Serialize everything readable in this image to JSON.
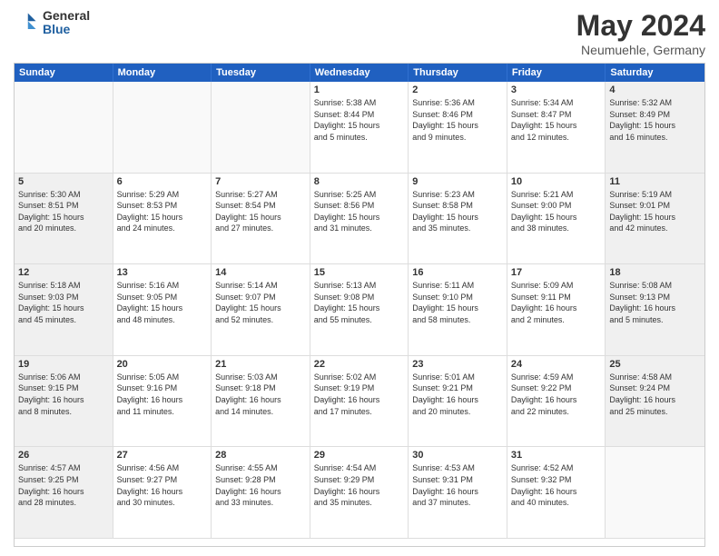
{
  "logo": {
    "general": "General",
    "blue": "Blue"
  },
  "header": {
    "month": "May 2024",
    "location": "Neumuehle, Germany"
  },
  "weekdays": [
    "Sunday",
    "Monday",
    "Tuesday",
    "Wednesday",
    "Thursday",
    "Friday",
    "Saturday"
  ],
  "weeks": [
    [
      {
        "day": "",
        "empty": true,
        "shaded": false
      },
      {
        "day": "",
        "empty": true,
        "shaded": false
      },
      {
        "day": "",
        "empty": true,
        "shaded": false
      },
      {
        "day": "1",
        "lines": [
          "Sunrise: 5:38 AM",
          "Sunset: 8:44 PM",
          "Daylight: 15 hours",
          "and 5 minutes."
        ]
      },
      {
        "day": "2",
        "lines": [
          "Sunrise: 5:36 AM",
          "Sunset: 8:46 PM",
          "Daylight: 15 hours",
          "and 9 minutes."
        ]
      },
      {
        "day": "3",
        "lines": [
          "Sunrise: 5:34 AM",
          "Sunset: 8:47 PM",
          "Daylight: 15 hours",
          "and 12 minutes."
        ]
      },
      {
        "day": "4",
        "lines": [
          "Sunrise: 5:32 AM",
          "Sunset: 8:49 PM",
          "Daylight: 15 hours",
          "and 16 minutes."
        ],
        "shaded": true
      }
    ],
    [
      {
        "day": "5",
        "lines": [
          "Sunrise: 5:30 AM",
          "Sunset: 8:51 PM",
          "Daylight: 15 hours",
          "and 20 minutes."
        ],
        "shaded": true
      },
      {
        "day": "6",
        "lines": [
          "Sunrise: 5:29 AM",
          "Sunset: 8:53 PM",
          "Daylight: 15 hours",
          "and 24 minutes."
        ]
      },
      {
        "day": "7",
        "lines": [
          "Sunrise: 5:27 AM",
          "Sunset: 8:54 PM",
          "Daylight: 15 hours",
          "and 27 minutes."
        ]
      },
      {
        "day": "8",
        "lines": [
          "Sunrise: 5:25 AM",
          "Sunset: 8:56 PM",
          "Daylight: 15 hours",
          "and 31 minutes."
        ]
      },
      {
        "day": "9",
        "lines": [
          "Sunrise: 5:23 AM",
          "Sunset: 8:58 PM",
          "Daylight: 15 hours",
          "and 35 minutes."
        ]
      },
      {
        "day": "10",
        "lines": [
          "Sunrise: 5:21 AM",
          "Sunset: 9:00 PM",
          "Daylight: 15 hours",
          "and 38 minutes."
        ]
      },
      {
        "day": "11",
        "lines": [
          "Sunrise: 5:19 AM",
          "Sunset: 9:01 PM",
          "Daylight: 15 hours",
          "and 42 minutes."
        ],
        "shaded": true
      }
    ],
    [
      {
        "day": "12",
        "lines": [
          "Sunrise: 5:18 AM",
          "Sunset: 9:03 PM",
          "Daylight: 15 hours",
          "and 45 minutes."
        ],
        "shaded": true
      },
      {
        "day": "13",
        "lines": [
          "Sunrise: 5:16 AM",
          "Sunset: 9:05 PM",
          "Daylight: 15 hours",
          "and 48 minutes."
        ]
      },
      {
        "day": "14",
        "lines": [
          "Sunrise: 5:14 AM",
          "Sunset: 9:07 PM",
          "Daylight: 15 hours",
          "and 52 minutes."
        ]
      },
      {
        "day": "15",
        "lines": [
          "Sunrise: 5:13 AM",
          "Sunset: 9:08 PM",
          "Daylight: 15 hours",
          "and 55 minutes."
        ]
      },
      {
        "day": "16",
        "lines": [
          "Sunrise: 5:11 AM",
          "Sunset: 9:10 PM",
          "Daylight: 15 hours",
          "and 58 minutes."
        ]
      },
      {
        "day": "17",
        "lines": [
          "Sunrise: 5:09 AM",
          "Sunset: 9:11 PM",
          "Daylight: 16 hours",
          "and 2 minutes."
        ]
      },
      {
        "day": "18",
        "lines": [
          "Sunrise: 5:08 AM",
          "Sunset: 9:13 PM",
          "Daylight: 16 hours",
          "and 5 minutes."
        ],
        "shaded": true
      }
    ],
    [
      {
        "day": "19",
        "lines": [
          "Sunrise: 5:06 AM",
          "Sunset: 9:15 PM",
          "Daylight: 16 hours",
          "and 8 minutes."
        ],
        "shaded": true
      },
      {
        "day": "20",
        "lines": [
          "Sunrise: 5:05 AM",
          "Sunset: 9:16 PM",
          "Daylight: 16 hours",
          "and 11 minutes."
        ]
      },
      {
        "day": "21",
        "lines": [
          "Sunrise: 5:03 AM",
          "Sunset: 9:18 PM",
          "Daylight: 16 hours",
          "and 14 minutes."
        ]
      },
      {
        "day": "22",
        "lines": [
          "Sunrise: 5:02 AM",
          "Sunset: 9:19 PM",
          "Daylight: 16 hours",
          "and 17 minutes."
        ]
      },
      {
        "day": "23",
        "lines": [
          "Sunrise: 5:01 AM",
          "Sunset: 9:21 PM",
          "Daylight: 16 hours",
          "and 20 minutes."
        ]
      },
      {
        "day": "24",
        "lines": [
          "Sunrise: 4:59 AM",
          "Sunset: 9:22 PM",
          "Daylight: 16 hours",
          "and 22 minutes."
        ]
      },
      {
        "day": "25",
        "lines": [
          "Sunrise: 4:58 AM",
          "Sunset: 9:24 PM",
          "Daylight: 16 hours",
          "and 25 minutes."
        ],
        "shaded": true
      }
    ],
    [
      {
        "day": "26",
        "lines": [
          "Sunrise: 4:57 AM",
          "Sunset: 9:25 PM",
          "Daylight: 16 hours",
          "and 28 minutes."
        ],
        "shaded": true
      },
      {
        "day": "27",
        "lines": [
          "Sunrise: 4:56 AM",
          "Sunset: 9:27 PM",
          "Daylight: 16 hours",
          "and 30 minutes."
        ]
      },
      {
        "day": "28",
        "lines": [
          "Sunrise: 4:55 AM",
          "Sunset: 9:28 PM",
          "Daylight: 16 hours",
          "and 33 minutes."
        ]
      },
      {
        "day": "29",
        "lines": [
          "Sunrise: 4:54 AM",
          "Sunset: 9:29 PM",
          "Daylight: 16 hours",
          "and 35 minutes."
        ]
      },
      {
        "day": "30",
        "lines": [
          "Sunrise: 4:53 AM",
          "Sunset: 9:31 PM",
          "Daylight: 16 hours",
          "and 37 minutes."
        ]
      },
      {
        "day": "31",
        "lines": [
          "Sunrise: 4:52 AM",
          "Sunset: 9:32 PM",
          "Daylight: 16 hours",
          "and 40 minutes."
        ]
      },
      {
        "day": "",
        "empty": true,
        "shaded": true
      }
    ]
  ]
}
